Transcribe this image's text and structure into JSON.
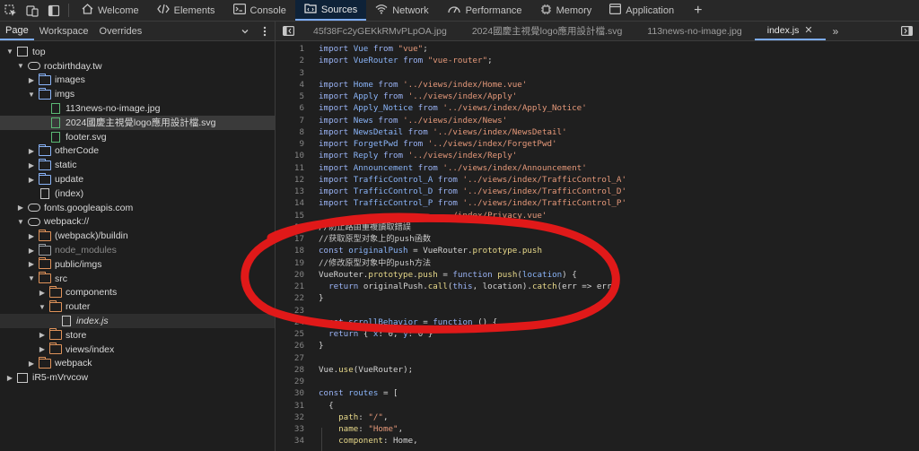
{
  "toolbar": {
    "tabs": [
      {
        "label": "Welcome",
        "icon": "home-icon"
      },
      {
        "label": "Elements",
        "icon": "code-icon"
      },
      {
        "label": "Console",
        "icon": "console-icon"
      },
      {
        "label": "Sources",
        "icon": "sources-icon",
        "active": true
      },
      {
        "label": "Network",
        "icon": "wifi-icon"
      },
      {
        "label": "Performance",
        "icon": "performance-icon"
      },
      {
        "label": "Memory",
        "icon": "memory-icon"
      },
      {
        "label": "Application",
        "icon": "application-icon"
      }
    ],
    "plus": "+"
  },
  "navigator": {
    "tabs": [
      "Page",
      "Workspace",
      "Overrides"
    ],
    "tree": [
      {
        "label": "top",
        "kind": "frame",
        "depth": 0,
        "caret": "down"
      },
      {
        "label": "rocbirthday.tw",
        "kind": "cloud",
        "depth": 1,
        "caret": "down"
      },
      {
        "label": "images",
        "kind": "folder",
        "depth": 2,
        "caret": "right"
      },
      {
        "label": "imgs",
        "kind": "folder",
        "depth": 2,
        "caret": "down"
      },
      {
        "label": "113news-no-image.jpg",
        "kind": "file-green",
        "depth": 3
      },
      {
        "label": "2024國慶主視覺logo應用設計檔.svg",
        "kind": "file-green",
        "depth": 3,
        "selected": true
      },
      {
        "label": "footer.svg",
        "kind": "file-green",
        "depth": 3
      },
      {
        "label": "otherCode",
        "kind": "folder",
        "depth": 2,
        "caret": "right"
      },
      {
        "label": "static",
        "kind": "folder",
        "depth": 2,
        "caret": "right"
      },
      {
        "label": "update",
        "kind": "folder",
        "depth": 2,
        "caret": "right"
      },
      {
        "label": "(index)",
        "kind": "file",
        "depth": 2
      },
      {
        "label": "fonts.googleapis.com",
        "kind": "cloud",
        "depth": 1,
        "caret": "right"
      },
      {
        "label": "webpack://",
        "kind": "cloud",
        "depth": 1,
        "caret": "down"
      },
      {
        "label": "(webpack)/buildin",
        "kind": "folder-orange",
        "depth": 2,
        "caret": "right"
      },
      {
        "label": "node_modules",
        "kind": "folder-dim",
        "depth": 2,
        "caret": "right",
        "dim": true
      },
      {
        "label": "public/imgs",
        "kind": "folder-orange",
        "depth": 2,
        "caret": "right"
      },
      {
        "label": "src",
        "kind": "folder-orange",
        "depth": 2,
        "caret": "down"
      },
      {
        "label": "components",
        "kind": "folder-orange",
        "depth": 3,
        "caret": "right"
      },
      {
        "label": "router",
        "kind": "folder-orange",
        "depth": 3,
        "caret": "down"
      },
      {
        "label": "index.js",
        "kind": "file",
        "depth": 4,
        "highlighted": true,
        "italic": true
      },
      {
        "label": "store",
        "kind": "folder-orange",
        "depth": 3,
        "caret": "right"
      },
      {
        "label": "views/index",
        "kind": "folder-orange",
        "depth": 3,
        "caret": "right"
      },
      {
        "label": "webpack",
        "kind": "folder-orange",
        "depth": 2,
        "caret": "right"
      },
      {
        "label": "iR5-mVrvcow",
        "kind": "frame",
        "depth": 0,
        "caret": "right"
      }
    ]
  },
  "editor_tabs": [
    {
      "label": "45f38Fc2yGEKkRMvPLpOA.jpg"
    },
    {
      "label": "2024國慶主視覺logo應用設計檔.svg"
    },
    {
      "label": "113news-no-image.jpg"
    },
    {
      "label": "index.js",
      "active": true,
      "close": "✕"
    }
  ],
  "code": {
    "start_line": 1,
    "lines": [
      [
        [
          "k",
          "import "
        ],
        [
          "v",
          "Vue "
        ],
        [
          "k",
          "from "
        ],
        [
          "s",
          "\"vue\""
        ],
        [
          "p",
          ";"
        ]
      ],
      [
        [
          "k",
          "import "
        ],
        [
          "v",
          "VueRouter "
        ],
        [
          "k",
          "from "
        ],
        [
          "s",
          "\"vue-router\""
        ],
        [
          "p",
          ";"
        ]
      ],
      [],
      [
        [
          "k",
          "import "
        ],
        [
          "v",
          "Home "
        ],
        [
          "k",
          "from "
        ],
        [
          "s",
          "'../views/index/Home.vue'"
        ]
      ],
      [
        [
          "k",
          "import "
        ],
        [
          "v",
          "Apply "
        ],
        [
          "k",
          "from "
        ],
        [
          "s",
          "'../views/index/Apply'"
        ]
      ],
      [
        [
          "k",
          "import "
        ],
        [
          "v",
          "Apply_Notice "
        ],
        [
          "k",
          "from "
        ],
        [
          "s",
          "'../views/index/Apply_Notice'"
        ]
      ],
      [
        [
          "k",
          "import "
        ],
        [
          "v",
          "News "
        ],
        [
          "k",
          "from "
        ],
        [
          "s",
          "'../views/index/News'"
        ]
      ],
      [
        [
          "k",
          "import "
        ],
        [
          "v",
          "NewsDetail "
        ],
        [
          "k",
          "from "
        ],
        [
          "s",
          "'../views/index/NewsDetail'"
        ]
      ],
      [
        [
          "k",
          "import "
        ],
        [
          "v",
          "ForgetPwd "
        ],
        [
          "k",
          "from "
        ],
        [
          "s",
          "'../views/index/ForgetPwd'"
        ]
      ],
      [
        [
          "k",
          "import "
        ],
        [
          "v",
          "Reply "
        ],
        [
          "k",
          "from "
        ],
        [
          "s",
          "'../views/index/Reply'"
        ]
      ],
      [
        [
          "k",
          "import "
        ],
        [
          "v",
          "Announcement "
        ],
        [
          "k",
          "from "
        ],
        [
          "s",
          "'../views/index/Announcement'"
        ]
      ],
      [
        [
          "k",
          "import "
        ],
        [
          "v",
          "TrafficControl_A "
        ],
        [
          "k",
          "from "
        ],
        [
          "s",
          "'../views/index/TrafficControl_A'"
        ]
      ],
      [
        [
          "k",
          "import "
        ],
        [
          "v",
          "TrafficControl_D "
        ],
        [
          "k",
          "from "
        ],
        [
          "s",
          "'../views/index/TrafficControl_D'"
        ]
      ],
      [
        [
          "k",
          "import "
        ],
        [
          "v",
          "TrafficControl_P "
        ],
        [
          "k",
          "from "
        ],
        [
          "s",
          "'../views/index/TrafficControl_P'"
        ]
      ],
      [
        [
          "s",
          "                           /index/Privacy.vue'"
        ]
      ],
      [
        [
          "c",
          "//防止路由重複讀取錯誤"
        ]
      ],
      [
        [
          "c",
          "//获取原型对象上的push函数"
        ]
      ],
      [
        [
          "k",
          "const "
        ],
        [
          "v",
          "originalPush "
        ],
        [
          "p",
          "= VueRouter."
        ],
        [
          "f",
          "prototype"
        ],
        [
          "p",
          "."
        ],
        [
          "f",
          "push"
        ]
      ],
      [
        [
          "c",
          "//修改原型对象中的push方法"
        ]
      ],
      [
        [
          "p",
          "VueRouter."
        ],
        [
          "f",
          "prototype"
        ],
        [
          "p",
          "."
        ],
        [
          "f",
          "push "
        ],
        [
          "p",
          "= "
        ],
        [
          "k",
          "function "
        ],
        [
          "f",
          "push"
        ],
        [
          "p",
          "("
        ],
        [
          "v",
          "location"
        ],
        [
          "p",
          ") {"
        ]
      ],
      [
        [
          "p",
          "  "
        ],
        [
          "k",
          "return "
        ],
        [
          "p",
          "originalPush."
        ],
        [
          "f",
          "call"
        ],
        [
          "p",
          "("
        ],
        [
          "k",
          "this"
        ],
        [
          "p",
          ", location)."
        ],
        [
          "f",
          "catch"
        ],
        [
          "p",
          "(err => err)"
        ]
      ],
      [
        [
          "p",
          "}"
        ]
      ],
      [],
      [
        [
          "k",
          "const "
        ],
        [
          "v",
          "scrollBehavior "
        ],
        [
          "p",
          "= "
        ],
        [
          "k",
          "function "
        ],
        [
          "p",
          "() {"
        ]
      ],
      [
        [
          "p",
          "  "
        ],
        [
          "k",
          "return "
        ],
        [
          "p",
          "{ "
        ],
        [
          "v",
          "x"
        ],
        [
          "p",
          ": 0, "
        ],
        [
          "v",
          "y"
        ],
        [
          "p",
          ": 0 }"
        ]
      ],
      [
        [
          "p",
          "}"
        ]
      ],
      [],
      [
        [
          "p",
          "Vue."
        ],
        [
          "f",
          "use"
        ],
        [
          "p",
          "(VueRouter);"
        ]
      ],
      [],
      [
        [
          "k",
          "const "
        ],
        [
          "v",
          "routes "
        ],
        [
          "p",
          "= ["
        ]
      ],
      [
        [
          "p",
          "  {"
        ]
      ],
      [
        [
          "p",
          "    "
        ],
        [
          "f",
          "path"
        ],
        [
          "p",
          ": "
        ],
        [
          "s",
          "\"/\""
        ],
        [
          "p",
          ","
        ]
      ],
      [
        [
          "p",
          "    "
        ],
        [
          "f",
          "name"
        ],
        [
          "p",
          ": "
        ],
        [
          "s",
          "\"Home\""
        ],
        [
          "p",
          ","
        ]
      ],
      [
        [
          "p",
          "    "
        ],
        [
          "f",
          "component"
        ],
        [
          "p",
          ": Home,"
        ]
      ]
    ]
  }
}
